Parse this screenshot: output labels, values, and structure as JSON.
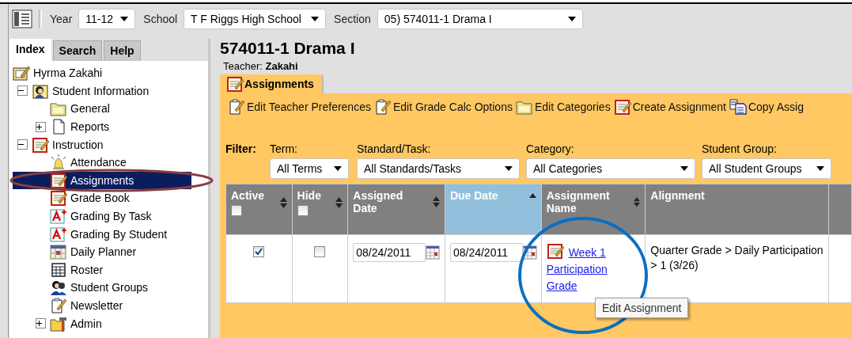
{
  "toolbar": {
    "fields": [
      {
        "label": "Year",
        "value": "11-12"
      },
      {
        "label": "School",
        "value": "T F Riggs High School"
      },
      {
        "label": "Section",
        "value": "05) 574011-1 Drama I"
      }
    ]
  },
  "nav_tabs": [
    {
      "label": "Index",
      "selected": true
    },
    {
      "label": "Search",
      "selected": false
    },
    {
      "label": "Help",
      "selected": false
    }
  ],
  "tree": [
    {
      "label": "Hyrma Zakahi",
      "kind": "card",
      "selected": false,
      "children": [
        {
          "label": "Student Information",
          "kind": "person",
          "selected": false,
          "expanded": true,
          "children": [
            {
              "label": "General",
              "kind": "folder",
              "selected": false
            },
            {
              "label": "Reports",
              "kind": "page",
              "selected": false,
              "expanded": false
            }
          ]
        },
        {
          "label": "Instruction",
          "kind": "notebook",
          "selected": false,
          "expanded": true,
          "children": [
            {
              "label": "Attendance",
              "kind": "bell",
              "selected": false
            },
            {
              "label": "Assignments",
              "kind": "notebook",
              "selected": true
            },
            {
              "label": "Grade Book",
              "kind": "notebook",
              "selected": false
            },
            {
              "label": "Grading By Task",
              "kind": "grade",
              "selected": false
            },
            {
              "label": "Grading By Student",
              "kind": "grade",
              "selected": false
            },
            {
              "label": "Daily Planner",
              "kind": "calendar",
              "selected": false
            },
            {
              "label": "Roster",
              "kind": "grid",
              "selected": false
            },
            {
              "label": "Student Groups",
              "kind": "people",
              "selected": false
            },
            {
              "label": "Newsletter",
              "kind": "clipboard",
              "selected": false
            },
            {
              "label": "Admin",
              "kind": "toolbox",
              "selected": false,
              "expanded": false
            }
          ]
        }
      ]
    }
  ],
  "title": "574011-1 Drama I",
  "teacher": "Teacher: **Zakahi**",
  "section_tabs": [
    {
      "label": "Assignments",
      "selected": true
    }
  ],
  "actions": [
    {
      "label": "Edit Teacher Preferences",
      "kind": "clipboard"
    },
    {
      "label": "Edit Grade Calc Options",
      "kind": "clipboard"
    },
    {
      "label": "Edit Categories",
      "kind": "folder"
    },
    {
      "label": "Create Assignment",
      "kind": "notebook"
    },
    {
      "label": "Copy Assig",
      "kind": "copy"
    }
  ],
  "filter": {
    "label": "Filter:",
    "fields": [
      {
        "label": "Term:",
        "value": "All Terms"
      },
      {
        "label": "Standard/Task:",
        "value": "All Standards/Tasks"
      },
      {
        "label": "Category:",
        "value": "All Categories"
      },
      {
        "label": "Student Group:",
        "value": "All Student Groups"
      }
    ]
  },
  "table": {
    "columns": [
      {
        "label": "Active",
        "sortable": true,
        "sorted": false,
        "checkbox": {
          "checked": false
        }
      },
      {
        "label": "Hide",
        "sortable": true,
        "sorted": false,
        "checkbox": {
          "checked": false
        }
      },
      {
        "label": "Assigned Date",
        "sortable": true,
        "sorted": false
      },
      {
        "label": "Due Date",
        "sortable": true,
        "sorted": true
      },
      {
        "label": "Assignment Name",
        "sortable": true,
        "sorted": false
      },
      {
        "label": "Alignment",
        "sortable": false,
        "sorted": false
      }
    ],
    "rows": [
      {
        "active": {
          "checked": true
        },
        "hide": {
          "checked": false
        },
        "assigned_date": "08/24/2011",
        "due_date": "08/24/2011",
        "assignment_name": "Week 1 Participation Grade",
        "alignment": "Quarter Grade > Daily Participation > 1 (3/26)"
      }
    ]
  },
  "tooltip": "Edit Assignment",
  "annotations": [
    {
      "color": "#8b3c3c"
    },
    {
      "color": "#0a6fc2"
    }
  ]
}
